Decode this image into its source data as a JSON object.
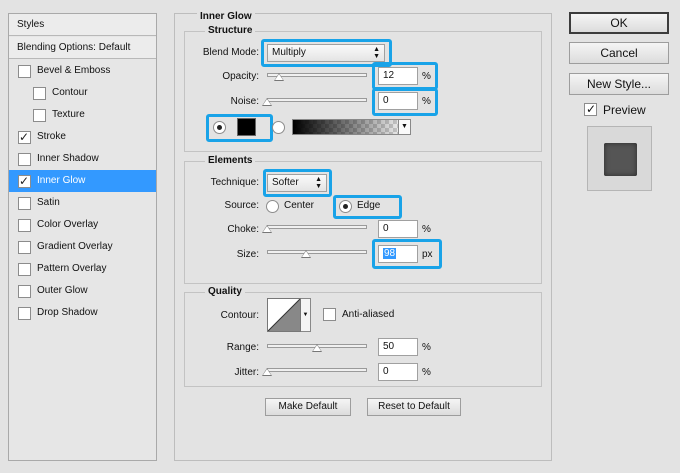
{
  "styles_panel": {
    "header": "Styles",
    "blending_options": "Blending Options: Default",
    "items": [
      {
        "label": "Bevel & Emboss",
        "checked": false,
        "indent": false,
        "selected": false
      },
      {
        "label": "Contour",
        "checked": false,
        "indent": true,
        "selected": false
      },
      {
        "label": "Texture",
        "checked": false,
        "indent": true,
        "selected": false
      },
      {
        "label": "Stroke",
        "checked": true,
        "indent": false,
        "selected": false
      },
      {
        "label": "Inner Shadow",
        "checked": false,
        "indent": false,
        "selected": false
      },
      {
        "label": "Inner Glow",
        "checked": true,
        "indent": false,
        "selected": true
      },
      {
        "label": "Satin",
        "checked": false,
        "indent": false,
        "selected": false
      },
      {
        "label": "Color Overlay",
        "checked": false,
        "indent": false,
        "selected": false
      },
      {
        "label": "Gradient Overlay",
        "checked": false,
        "indent": false,
        "selected": false
      },
      {
        "label": "Pattern Overlay",
        "checked": false,
        "indent": false,
        "selected": false
      },
      {
        "label": "Outer Glow",
        "checked": false,
        "indent": false,
        "selected": false
      },
      {
        "label": "Drop Shadow",
        "checked": false,
        "indent": false,
        "selected": false
      }
    ]
  },
  "inner_glow": {
    "title": "Inner Glow",
    "structure": {
      "title": "Structure",
      "blend_mode_label": "Blend Mode:",
      "blend_mode_value": "Multiply",
      "opacity_label": "Opacity:",
      "opacity_value": "12",
      "opacity_unit": "%",
      "opacity_level": 12,
      "noise_label": "Noise:",
      "noise_value": "0",
      "noise_unit": "%",
      "noise_level": 0,
      "color_swatch": "#000000"
    },
    "elements": {
      "title": "Elements",
      "technique_label": "Technique:",
      "technique_value": "Softer",
      "source_label": "Source:",
      "source_center": "Center",
      "source_edge": "Edge",
      "choke_label": "Choke:",
      "choke_value": "0",
      "choke_unit": "%",
      "choke_level": 0,
      "size_label": "Size:",
      "size_value": "98",
      "size_unit": "px",
      "size_level": 39
    },
    "quality": {
      "title": "Quality",
      "contour_label": "Contour:",
      "anti_aliased_label": "Anti-aliased",
      "range_label": "Range:",
      "range_value": "50",
      "range_unit": "%",
      "range_level": 50,
      "jitter_label": "Jitter:",
      "jitter_value": "0",
      "jitter_unit": "%",
      "jitter_level": 0
    },
    "make_default": "Make Default",
    "reset_to_default": "Reset to Default"
  },
  "buttons": {
    "ok": "OK",
    "cancel": "Cancel",
    "new_style": "New Style...",
    "preview_label": "Preview"
  },
  "colors": {
    "highlight": "#19a3e8",
    "selected_row": "#3399ff"
  }
}
